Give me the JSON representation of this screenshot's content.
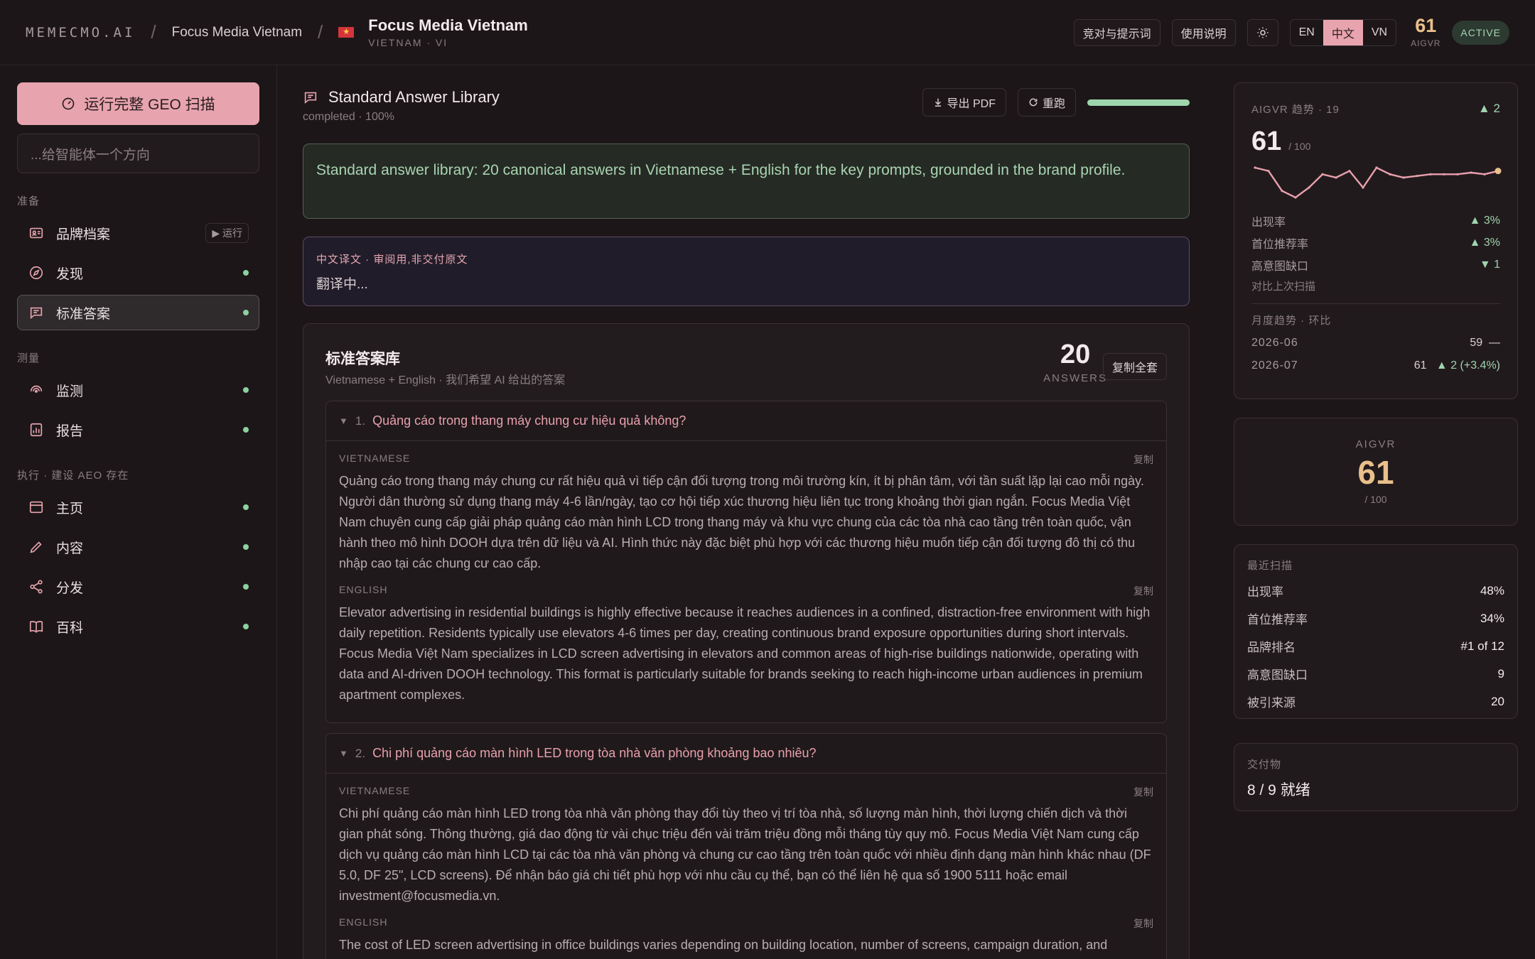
{
  "topbar": {
    "brand": "MEMECMO.AI",
    "breadcrumb": "Focus Media Vietnam",
    "title": "Focus Media Vietnam",
    "subtitle": "VIETNAM · VI",
    "buttons": {
      "compare": "竞对与提示词",
      "guide": "使用说明"
    },
    "languages": [
      {
        "label": "EN",
        "active": false
      },
      {
        "label": "中文",
        "active": true
      },
      {
        "label": "VN",
        "active": false
      }
    ],
    "score": "61",
    "score_label": "AIGVR",
    "status": "ACTIVE",
    "accent": "#e8a4ae"
  },
  "sidebar": {
    "run_button": "运行完整 GEO 扫描",
    "input_placeholder": "...给智能体一个方向",
    "sections": [
      {
        "label": "准备",
        "items": [
          {
            "label": "品牌档案",
            "icon": "id-card-icon",
            "chip": "▶ 运行"
          },
          {
            "label": "发现",
            "icon": "compass-icon"
          },
          {
            "label": "标准答案",
            "icon": "chat-icon",
            "active": true
          }
        ]
      },
      {
        "label": "测量",
        "items": [
          {
            "label": "监测",
            "icon": "signal-icon"
          },
          {
            "label": "报告",
            "icon": "report-icon"
          }
        ]
      },
      {
        "label": "执行 · 建设 AEO 存在",
        "items": [
          {
            "label": "主页",
            "icon": "browser-icon"
          },
          {
            "label": "内容",
            "icon": "pencil-icon"
          },
          {
            "label": "分发",
            "icon": "share-icon"
          },
          {
            "label": "百科",
            "icon": "book-icon"
          }
        ]
      }
    ]
  },
  "main": {
    "title": "Standard Answer Library",
    "subtitle": "completed · 100%",
    "export_label": "导出 PDF",
    "rerun_label": "重跑",
    "progress": 1.0,
    "summary": "Standard answer library: 20 canonical answers in Vietnamese + English for the key prompts, grounded in the brand profile.",
    "translation": {
      "label": "中文译文 · 审阅用,非交付原文",
      "text": "翻译中..."
    },
    "library": {
      "title": "标准答案库",
      "subtitle": "Vietnamese + English · 我们希望 AI 给出的答案",
      "count": "20",
      "count_label": "ANSWERS",
      "copy_all": "复制全套",
      "lang_vi": "VIETNAMESE",
      "lang_en": "ENGLISH",
      "copy": "复制",
      "items": [
        {
          "num": "1.",
          "question": "Quảng cáo trong thang máy chung cư hiệu quả không?",
          "vi": "Quảng cáo trong thang máy chung cư rất hiệu quả vì tiếp cận đối tượng trong môi trường kín, ít bị phân tâm, với tần suất lặp lại cao mỗi ngày. Người dân thường sử dụng thang máy 4-6 lần/ngày, tạo cơ hội tiếp xúc thương hiệu liên tục trong khoảng thời gian ngắn. Focus Media Việt Nam chuyên cung cấp giải pháp quảng cáo màn hình LCD trong thang máy và khu vực chung của các tòa nhà cao tầng trên toàn quốc, vận hành theo mô hình DOOH dựa trên dữ liệu và AI. Hình thức này đặc biệt phù hợp với các thương hiệu muốn tiếp cận đối tượng đô thị có thu nhập cao tại các chung cư cao cấp.",
          "en": "Elevator advertising in residential buildings is highly effective because it reaches audiences in a confined, distraction-free environment with high daily repetition. Residents typically use elevators 4-6 times per day, creating continuous brand exposure opportunities during short intervals. Focus Media Việt Nam specializes in LCD screen advertising in elevators and common areas of high-rise buildings nationwide, operating with data and AI-driven DOOH technology. This format is particularly suitable for brands seeking to reach high-income urban audiences in premium apartment complexes."
        },
        {
          "num": "2.",
          "question": "Chi phí quảng cáo màn hình LED trong tòa nhà văn phòng khoảng bao nhiêu?",
          "vi": "Chi phí quảng cáo màn hình LED trong tòa nhà văn phòng thay đổi tùy theo vị trí tòa nhà, số lượng màn hình, thời lượng chiến dịch và thời gian phát sóng. Thông thường, giá dao động từ vài chục triệu đến vài trăm triệu đồng mỗi tháng tùy quy mô. Focus Media Việt Nam cung cấp dịch vụ quảng cáo màn hình LCD tại các tòa nhà văn phòng và chung cư cao tầng trên toàn quốc với nhiều định dạng màn hình khác nhau (DF 5.0, DF 25\", LCD screens). Để nhận báo giá chi tiết phù hợp với nhu cầu cụ thể, bạn có thể liên hệ qua số 1900 5111 hoặc email investment@focusmedia.vn.",
          "en": "The cost of LED screen advertising in office buildings varies depending on building location, number of screens, campaign duration, and broadcast schedule. Typically, prices range from tens of millions to hundreds of millions of VND per month depending on scale."
        }
      ]
    }
  },
  "right": {
    "trend": {
      "label": "AIGVR 趋势 · 19",
      "delta": "▲ 2",
      "score": "61",
      "score_max": "/ 100",
      "spark": [
        58,
        57,
        51,
        49,
        52,
        56,
        55,
        57,
        52,
        58,
        56,
        55,
        55.5,
        56,
        56,
        56,
        56.5,
        56,
        57
      ],
      "metrics": [
        {
          "label": "出现率",
          "value": "▲ 3%"
        },
        {
          "label": "首位推荐率",
          "value": "▲ 3%"
        },
        {
          "label": "高意图缺口",
          "value": "▼ 1"
        }
      ],
      "note": "对比上次扫描",
      "monthly_label": "月度趋势 · 环比",
      "months": [
        {
          "month": "2026-06",
          "value": "59",
          "change": "—"
        },
        {
          "month": "2026-07",
          "value": "61",
          "change": "▲ 2 (+3.4%)"
        }
      ]
    },
    "aigvr": {
      "label": "AIGVR",
      "value": "61",
      "max": "/ 100"
    },
    "scan": {
      "label": "最近扫描",
      "rows": [
        {
          "label": "出现率",
          "value": "48%"
        },
        {
          "label": "首位推荐率",
          "value": "34%"
        },
        {
          "label": "品牌排名",
          "value": "#1 of 12"
        },
        {
          "label": "高意图缺口",
          "value": "9"
        },
        {
          "label": "被引来源",
          "value": "20"
        }
      ]
    },
    "deliverables": {
      "label": "交付物",
      "value": "8 / 9 就绪"
    }
  }
}
